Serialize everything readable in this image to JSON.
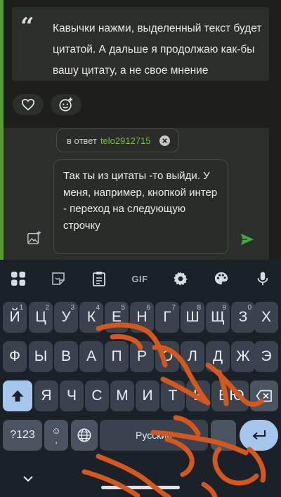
{
  "quote": {
    "text": "Кавычки нажми, выделенный текст будет цитатой. А дальше я продолжаю как-бы вашу цитату, а не свое мнение"
  },
  "reactions": {
    "like_icon": "heart-outline-icon",
    "add_icon": "add-reaction-icon"
  },
  "reply": {
    "prefix": "в ответ",
    "username": "telo2912715",
    "close_icon": "close-circle-icon"
  },
  "message": {
    "text": "Так ты из цитаты -то выйди. У меня, например, кнопкой интер - переход на следующую строчку"
  },
  "colors": {
    "accent_green": "#5a9a35",
    "username_green": "#7dbb4a",
    "send_green": "#3fa93c",
    "scribble_orange": "#d4581e"
  },
  "keyboard": {
    "toolbar": {
      "gif": "GIF",
      "icons": [
        "apps-grid-icon",
        "sticker-icon",
        "clipboard-icon",
        "gif-icon",
        "settings-gear-icon",
        "theme-palette-icon",
        "microphone-icon"
      ]
    },
    "row1": [
      "Й",
      "Ц",
      "У",
      "К",
      "Е",
      "Н",
      "Г",
      "Ш",
      "Щ",
      "З",
      "Х"
    ],
    "row1_hints": [
      "1",
      "2",
      "3",
      "4",
      "5",
      "6",
      "7",
      "8",
      "9",
      "0",
      ""
    ],
    "row2": [
      "Ф",
      "Ы",
      "В",
      "А",
      "П",
      "Р",
      "О",
      "Л",
      "Д",
      "Ж",
      "Э"
    ],
    "row3": [
      "Я",
      "Ч",
      "С",
      "М",
      "И",
      "Т",
      "Ь",
      "Б",
      "Ю"
    ],
    "symbols_key": "?123",
    "emoji_top": "☺",
    "emoji_bottom": ",",
    "space_label": "Русский",
    "special_icons": [
      "shift-icon",
      "backspace-icon",
      "globe-icon",
      "enter-icon",
      "hide-keyboard-chevron-icon"
    ]
  }
}
